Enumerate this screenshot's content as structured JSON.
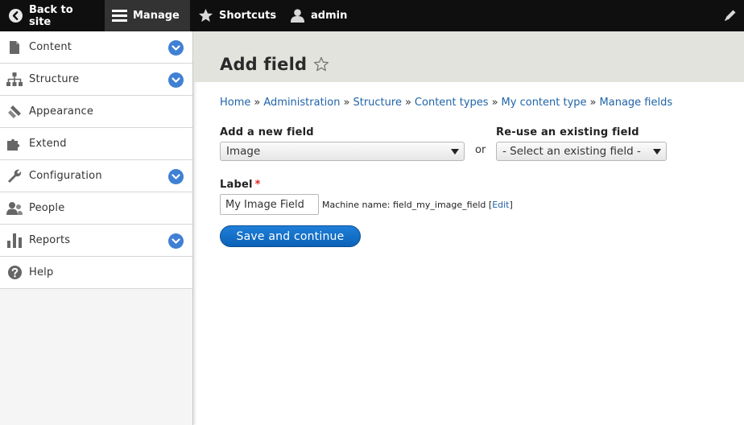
{
  "toolbar": {
    "back_label": "Back to site",
    "manage_label": "Manage",
    "shortcuts_label": "Shortcuts",
    "admin_label": "admin",
    "icons": {
      "back": "chevron-left-circle-icon",
      "manage": "hamburger-icon",
      "shortcuts": "star-icon",
      "admin": "user-icon",
      "edit": "pencil-icon"
    }
  },
  "sidebar": {
    "items": [
      {
        "label": "Content",
        "icon": "file-icon",
        "expandable": true
      },
      {
        "label": "Structure",
        "icon": "sitemap-icon",
        "expandable": true
      },
      {
        "label": "Appearance",
        "icon": "paintbrush-icon",
        "expandable": false
      },
      {
        "label": "Extend",
        "icon": "puzzle-icon",
        "expandable": false
      },
      {
        "label": "Configuration",
        "icon": "wrench-icon",
        "expandable": true
      },
      {
        "label": "People",
        "icon": "people-icon",
        "expandable": false
      },
      {
        "label": "Reports",
        "icon": "bar-chart-icon",
        "expandable": true
      },
      {
        "label": "Help",
        "icon": "question-icon",
        "expandable": false
      }
    ]
  },
  "page": {
    "title": "Add field"
  },
  "breadcrumb": [
    "Home",
    "Administration",
    "Structure",
    "Content types",
    "My content type",
    "Manage fields"
  ],
  "breadcrumb_separator": "»",
  "form": {
    "new_field_label": "Add a new field",
    "new_field_value": "Image",
    "or_text": "or",
    "existing_field_label": "Re-use an existing field",
    "existing_field_value": "- Select an existing field -",
    "label_label": "Label",
    "required_mark": "*",
    "label_value": "My Image Field",
    "machine_name_prefix": "Machine name: field_my_image_field [",
    "machine_name_edit": "Edit",
    "machine_name_suffix": "]",
    "submit_label": "Save and continue"
  },
  "colors": {
    "toolbar_bg": "#0f0f0f",
    "link": "#1f63a8",
    "accent": "#3f80d4",
    "primary_button": "#0a62b8",
    "required": "#e0241b"
  }
}
